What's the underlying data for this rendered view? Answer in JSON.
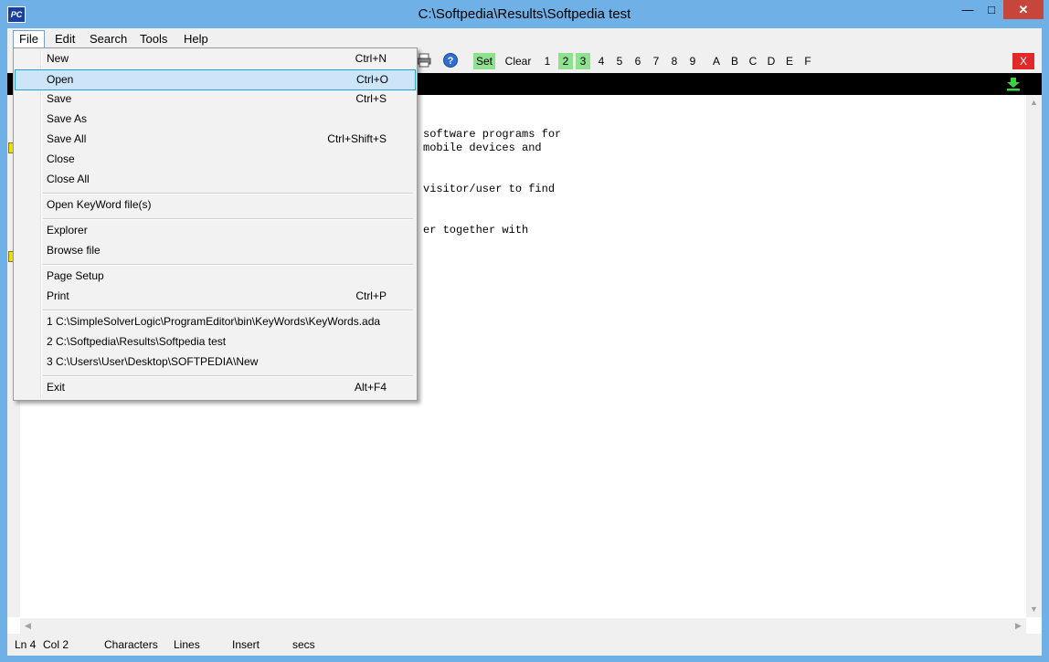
{
  "window": {
    "title": "C:\\Softpedia\\Results\\Softpedia test",
    "app_icon_text": "PC",
    "minimize": "—",
    "maximize": "□",
    "close": "✕"
  },
  "menubar": {
    "items": [
      "File",
      "Edit",
      "Search",
      "Tools",
      "Help"
    ]
  },
  "toolbar": {
    "set_label": "Set",
    "clear_label": "Clear",
    "numbers": [
      "1",
      "2",
      "3",
      "4",
      "5",
      "6",
      "7",
      "8",
      "9"
    ],
    "green_numbers": [
      "2",
      "3"
    ],
    "letters": [
      "A",
      "B",
      "C",
      "D",
      "E",
      "F"
    ],
    "close_label": "X",
    "icons": [
      "print-icon",
      "help-icon"
    ]
  },
  "editor": {
    "lines": [
      "software programs for",
      "mobile devices and",
      "visitor/user to find",
      "er together with"
    ]
  },
  "status": {
    "ln": "Ln 4",
    "col": "Col 2",
    "characters": "Characters",
    "lines": "Lines",
    "insert": "Insert",
    "secs": "secs"
  },
  "file_menu": {
    "items": [
      {
        "label": "New",
        "shortcut": "Ctrl+N"
      },
      {
        "label": "Open",
        "shortcut": "Ctrl+O",
        "highlighted": true
      },
      {
        "label": "Save",
        "shortcut": "Ctrl+S"
      },
      {
        "label": "Save As",
        "shortcut": ""
      },
      {
        "label": "Save All",
        "shortcut": "Ctrl+Shift+S"
      },
      {
        "label": "Close",
        "shortcut": ""
      },
      {
        "label": "Close All",
        "shortcut": ""
      },
      {
        "label": "Open KeyWord file(s)",
        "shortcut": ""
      },
      {
        "label": "Explorer",
        "shortcut": ""
      },
      {
        "label": "Browse file",
        "shortcut": ""
      },
      {
        "label": "Page Setup",
        "shortcut": ""
      },
      {
        "label": "Print",
        "shortcut": "Ctrl+P"
      },
      {
        "label": "1  C:\\SimpleSolverLogic\\ProgramEditor\\bin\\KeyWords\\KeyWords.ada",
        "shortcut": ""
      },
      {
        "label": "2  C:\\Softpedia\\Results\\Softpedia test",
        "shortcut": ""
      },
      {
        "label": "3  C:\\Users\\User\\Desktop\\SOFTPEDIA\\New",
        "shortcut": ""
      },
      {
        "label": "Exit",
        "shortcut": "Alt+F4"
      }
    ]
  },
  "colors": {
    "titlebar": "#6fb0e6",
    "highlight": "#cde6f7",
    "green_button": "#8fe08f",
    "close_red": "#e02a2a"
  }
}
